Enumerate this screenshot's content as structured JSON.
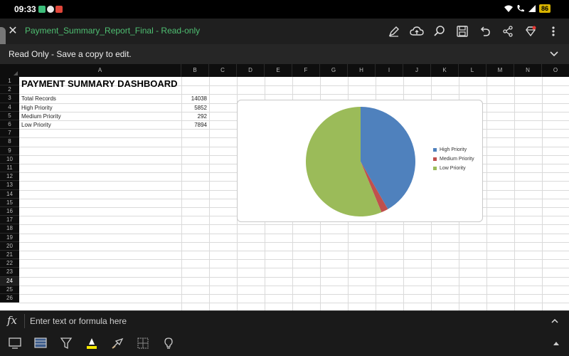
{
  "status_bar": {
    "time": "09:33",
    "battery": "86"
  },
  "app": {
    "doc_title": "Payment_Summary_Report_Final - Read-only",
    "readonly_message": "Read Only - Save a copy to edit."
  },
  "sheet": {
    "columns": [
      "A",
      "B",
      "C",
      "D",
      "E",
      "F",
      "G",
      "H",
      "I",
      "J",
      "K",
      "L",
      "M",
      "N",
      "O"
    ],
    "rows": [
      "1",
      "2",
      "3",
      "4",
      "5",
      "6",
      "7",
      "8",
      "9",
      "10",
      "11",
      "12",
      "13",
      "14",
      "15",
      "16",
      "17",
      "18",
      "19",
      "20",
      "21",
      "22",
      "23",
      "24",
      "25",
      "26"
    ],
    "selected_row": "24",
    "title": "PAYMENT SUMMARY DASHBOARD",
    "table": [
      {
        "label": "Total Records",
        "value": "14038"
      },
      {
        "label": "High Priority",
        "value": "5852"
      },
      {
        "label": "Medium Priority",
        "value": "292"
      },
      {
        "label": "Low Priority",
        "value": "7894"
      }
    ]
  },
  "chart_data": {
    "type": "pie",
    "categories": [
      "High Priority",
      "Medium Priority",
      "Low Priority"
    ],
    "values": [
      5852,
      292,
      7894
    ],
    "colors": [
      "#4f81bd",
      "#c0504d",
      "#9bbb59"
    ],
    "legend": "right"
  },
  "formula_bar": {
    "placeholder": "Enter text or formula here"
  },
  "colors": {
    "title_green": "#4fbf72",
    "highlight_yellow": "#f5e700"
  }
}
